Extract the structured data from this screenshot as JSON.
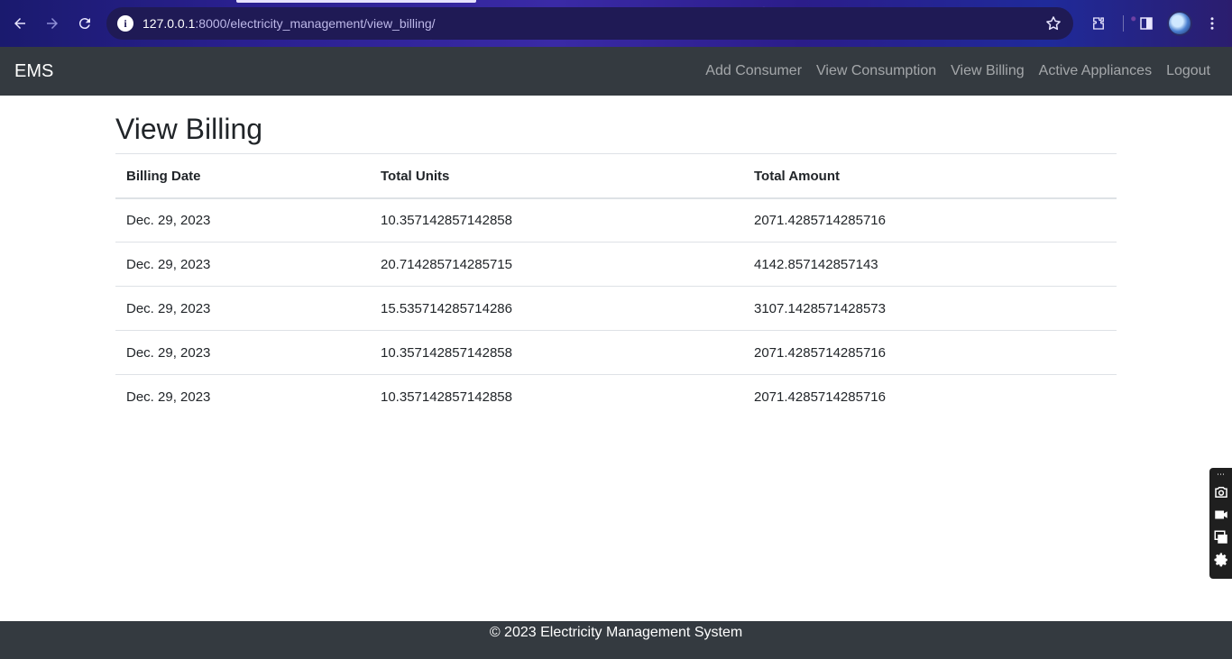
{
  "browser": {
    "url_host": "127.0.0.1",
    "url_rest": ":8000/electricity_management/view_billing/"
  },
  "navbar": {
    "brand": "EMS",
    "links": [
      {
        "label": "Add Consumer"
      },
      {
        "label": "View Consumption"
      },
      {
        "label": "View Billing"
      },
      {
        "label": "Active Appliances"
      },
      {
        "label": "Logout"
      }
    ]
  },
  "page": {
    "title": "View Billing"
  },
  "table": {
    "headers": [
      "Billing Date",
      "Total Units",
      "Total Amount"
    ],
    "rows": [
      [
        "Dec. 29, 2023",
        "10.357142857142858",
        "2071.4285714285716"
      ],
      [
        "Dec. 29, 2023",
        "20.714285714285715",
        "4142.857142857143"
      ],
      [
        "Dec. 29, 2023",
        "15.535714285714286",
        "3107.1428571428573"
      ],
      [
        "Dec. 29, 2023",
        "10.357142857142858",
        "2071.4285714285716"
      ],
      [
        "Dec. 29, 2023",
        "10.357142857142858",
        "2071.4285714285716"
      ]
    ]
  },
  "footer": {
    "text": "© 2023 Electricity Management System"
  },
  "colors": {
    "navbar_bg": "#343a40",
    "browser_accent": "#2a2090"
  }
}
